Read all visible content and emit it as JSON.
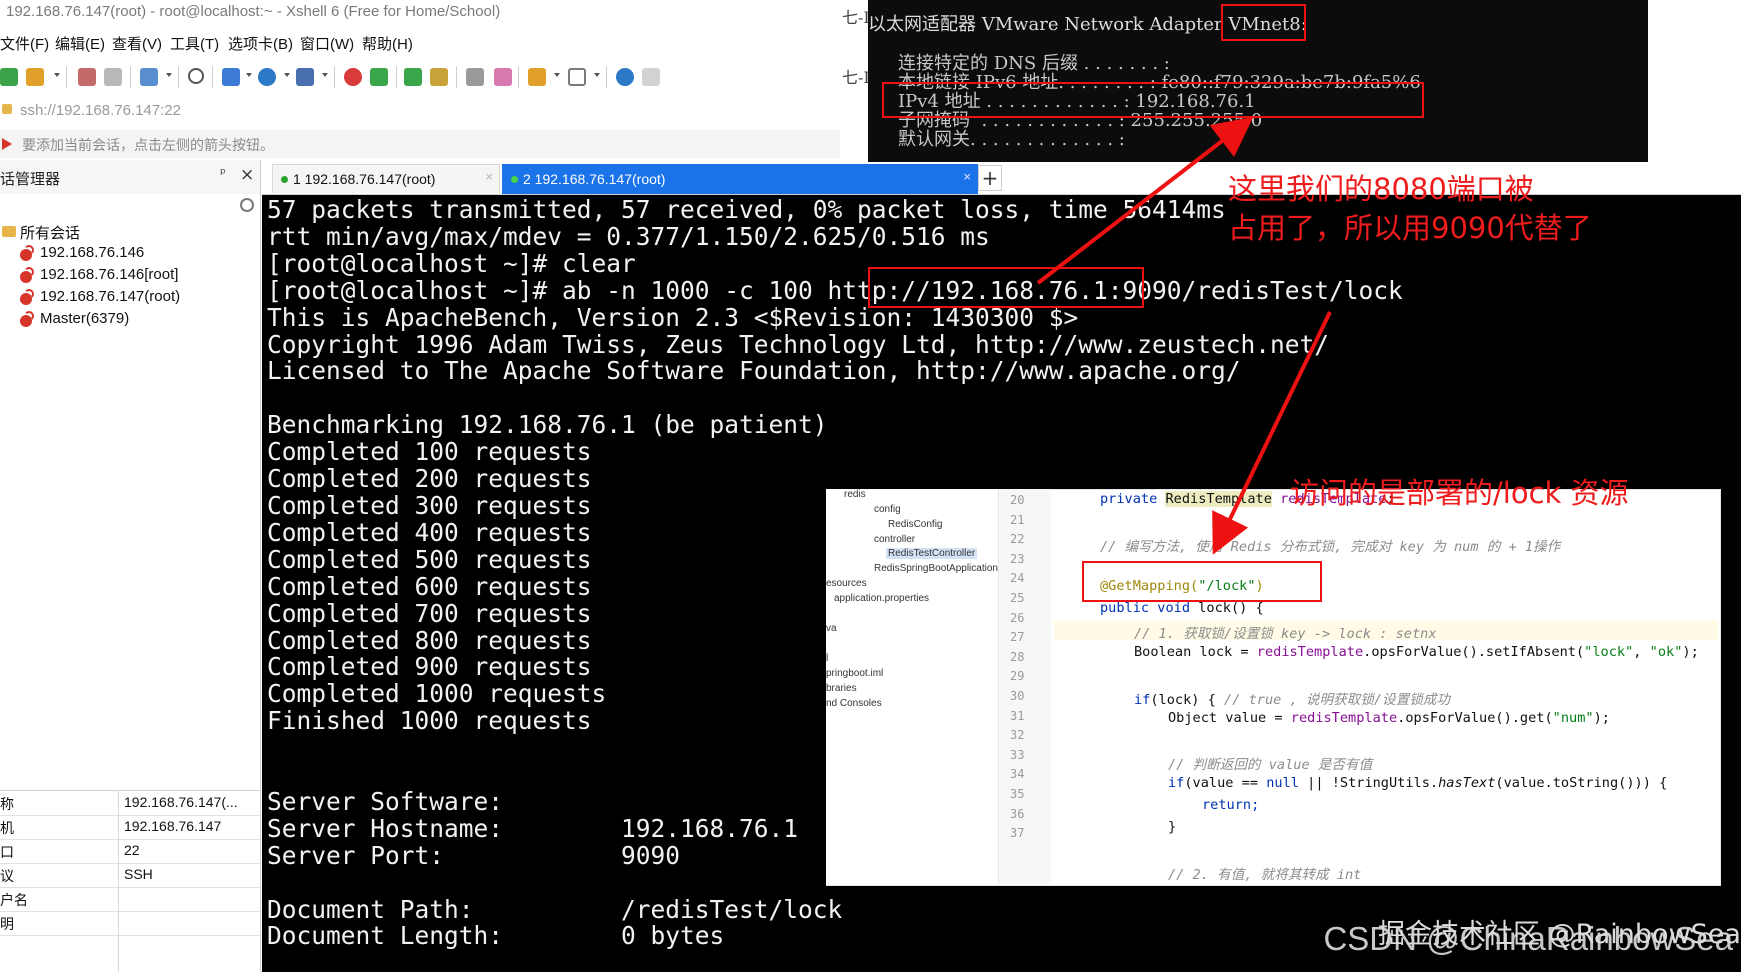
{
  "window": {
    "title": "192.168.76.147(root) - root@localhost:~ - Xshell 6 (Free for Home/School)"
  },
  "menu": [
    "文件(F)",
    "编辑(E)",
    "查看(V)",
    "工具(T)",
    "选项卡(B)",
    "窗口(W)",
    "帮助(H)"
  ],
  "address": {
    "value": "ssh://192.168.76.147:22"
  },
  "hint": {
    "text": "要添加当前会话，点击左侧的箭头按钮。"
  },
  "session_manager": {
    "title": "话管理器",
    "pin": "ᵖ",
    "close": "×",
    "root_folder": "所有会话",
    "sessions": [
      "192.168.76.146",
      "192.168.76.146[root]",
      "192.168.76.147(root)",
      "Master(6379)"
    ]
  },
  "properties": [
    {
      "key": "称",
      "value": "192.168.76.147(..."
    },
    {
      "key": "机",
      "value": "192.168.76.147"
    },
    {
      "key": "口",
      "value": "22"
    },
    {
      "key": "议",
      "value": "SSH"
    },
    {
      "key": "户名",
      "value": ""
    },
    {
      "key": "明",
      "value": ""
    }
  ],
  "tabs": [
    {
      "label": "1 192.168.76.147(root)",
      "active": false
    },
    {
      "label": "2 192.168.76.147(root)",
      "active": true
    }
  ],
  "tab_add": "+",
  "terminal": {
    "lines": [
      "57 packets transmitted, 57 received, 0% packet loss, time 56414ms",
      "rtt min/avg/max/mdev = 0.377/1.150/2.625/0.516 ms",
      "[root@localhost ~]# clear",
      "[root@localhost ~]# ab -n 1000 -c 100 http://192.168.76.1:9090/redisTest/lock",
      "This is ApacheBench, Version 2.3 <$Revision: 1430300 $>",
      "Copyright 1996 Adam Twiss, Zeus Technology Ltd, http://www.zeustech.net/",
      "Licensed to The Apache Software Foundation, http://www.apache.org/",
      "",
      "Benchmarking 192.168.76.1 (be patient)",
      "Completed 100 requests",
      "Completed 200 requests",
      "Completed 300 requests",
      "Completed 400 requests",
      "Completed 500 requests",
      "Completed 600 requests",
      "Completed 700 requests",
      "Completed 800 requests",
      "Completed 900 requests",
      "Completed 1000 requests",
      "Finished 1000 requests",
      "",
      "",
      "Server Software:",
      "Server Hostname:        192.168.76.1",
      "Server Port:            9090",
      "",
      "Document Path:          /redisTest/lock",
      "Document Length:        0 bytes"
    ]
  },
  "ipconfig": {
    "header": "以太网适配器 VMware Network Adapter VMnet8:",
    "header_left": "以太网适配器 VMware Network Adapter ",
    "header_iface": "VMnet8:",
    "rows": [
      "连接特定的 DNS 后缀 . . . . . . . :",
      "本地链接 IPv6 地址. . . . . . . . : fe80::f79:329a:be7b:9fa5%6",
      "IPv4 地址 . . . . . . . . . . . . : 192.168.76.1",
      "子网掩码  . . . . . . . . . . . . : 255.255.255.0",
      "默认网关. . . . . . . . . . . . . :"
    ],
    "left_fragments": [
      "七-L",
      "七-L"
    ]
  },
  "ide": {
    "tree": [
      "redis",
      "config",
      "RedisConfig",
      "controller",
      "RedisTestController",
      "RedisSpringBootApplication",
      "esources",
      "application.properties",
      "va",
      "l",
      "pringboot.iml",
      "braries",
      "nd Consoles"
    ],
    "line_numbers": [
      "20",
      "21",
      "22",
      "23",
      "24",
      "25",
      "26",
      "27",
      "28",
      "29",
      "30",
      "31",
      "32",
      "33",
      "34",
      "35",
      "36",
      "37"
    ],
    "code": {
      "l20": "private RedisTemplate redisTemplate;",
      "l22": "// 编写方法, 使用 Redis 分布式锁, 完成对 key 为 num 的 + 1操作",
      "l24": "@GetMapping(\"/lock\")",
      "l25": "public void lock() {",
      "l26": "// 1. 获取锁/设置锁 key -> lock : setnx",
      "l27": "Boolean lock = redisTemplate.opsForValue().setIfAbsent(\"lock\", \"ok\");",
      "l29": "if(lock) { // true , 说明获取锁/设置锁成功",
      "l30": "Object value = redisTemplate.opsForValue().get(\"num\");",
      "l32": "// 判断返回的 value 是否有值",
      "l33": "if(value == null || !StringUtils.hasText(value.toString())) {",
      "l34": "return;",
      "l35": "}",
      "l37": "// 2. 有值, 就将其转成 int"
    }
  },
  "annotations": {
    "port_note_line1": "这里我们的8080端口被",
    "port_note_line2": "占用了，所以用9090代替了",
    "resource_note": "访问的是部署的/lock 资源"
  },
  "watermark": {
    "main": "CSDN @ChinaRainbowSea",
    "overlay": "掘金技术社区 @RainbowSea"
  },
  "colors": {
    "annotation_red": "#ee1111",
    "terminal_bg": "#000000",
    "active_tab": "#1a73e8",
    "session_green": "#2aa02a"
  }
}
